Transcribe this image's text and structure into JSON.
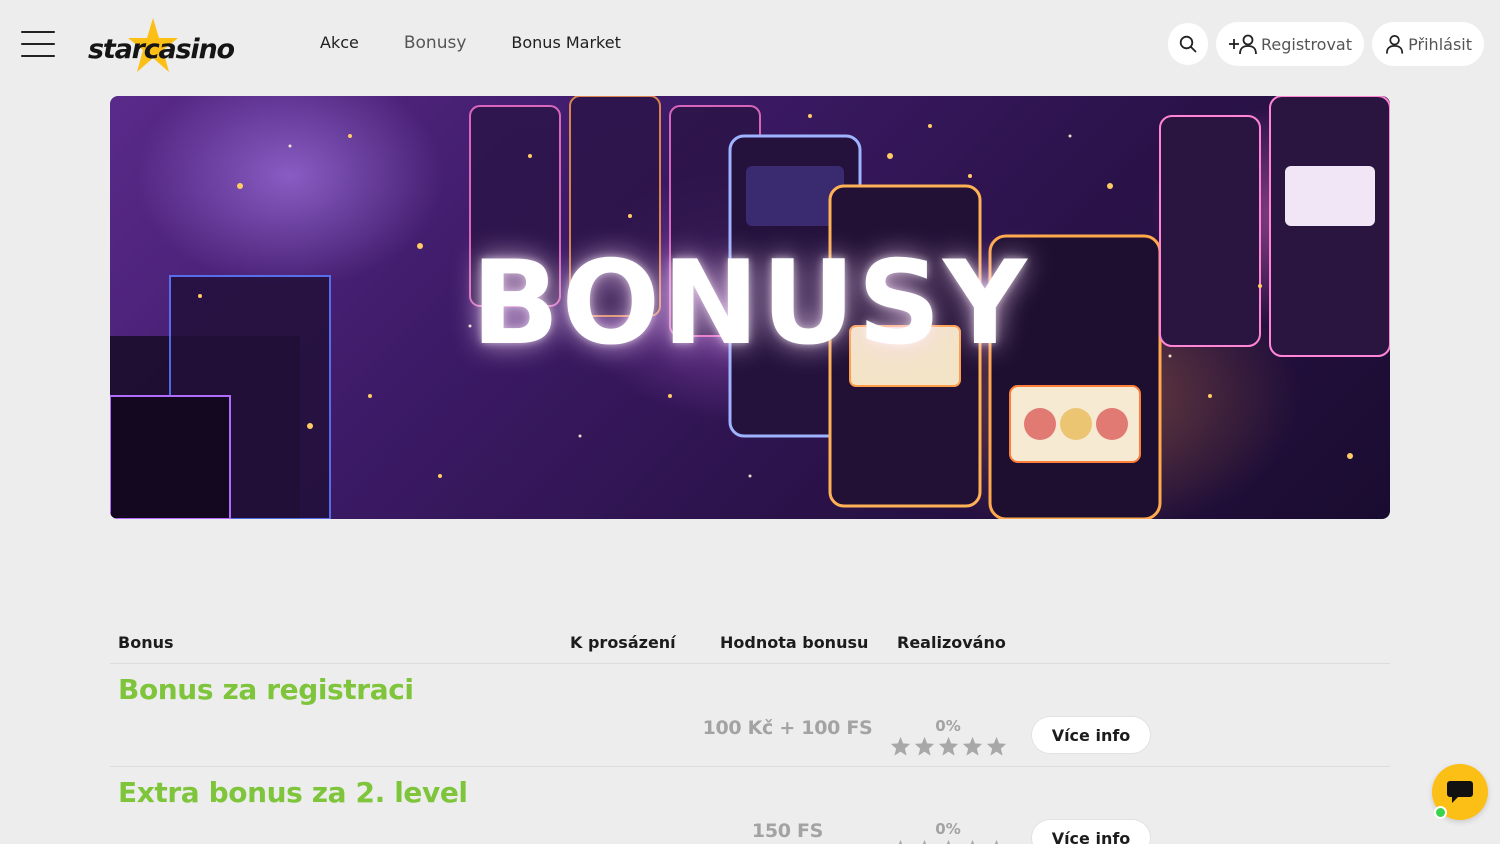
{
  "brand": {
    "logo_text": "starcasino"
  },
  "nav": {
    "items": [
      {
        "label": "Akce"
      },
      {
        "label": "Bonusy"
      },
      {
        "label": "Bonus Market"
      }
    ]
  },
  "header": {
    "register_label": "Registrovat",
    "login_label": "Přihlásit"
  },
  "hero": {
    "title": "BONUSY"
  },
  "table": {
    "columns": [
      "Bonus",
      "K prosázení",
      "Hodnota bonusu",
      "Realizováno"
    ],
    "rows": [
      {
        "title": "Bonus za registraci",
        "value": "100 Kč + 100 FS",
        "realized": "0%",
        "rating": 0,
        "button": "Více info"
      },
      {
        "title": "Extra bonus za 2. level",
        "value": "150 FS",
        "realized": "0%",
        "rating": 0,
        "button": "Více info"
      }
    ]
  },
  "colors": {
    "background": "#ededed",
    "accent_green": "#7fc53b",
    "brand_yellow": "#fbbf16",
    "muted_text": "#a3a3a3",
    "online_green": "#3ad34c"
  }
}
